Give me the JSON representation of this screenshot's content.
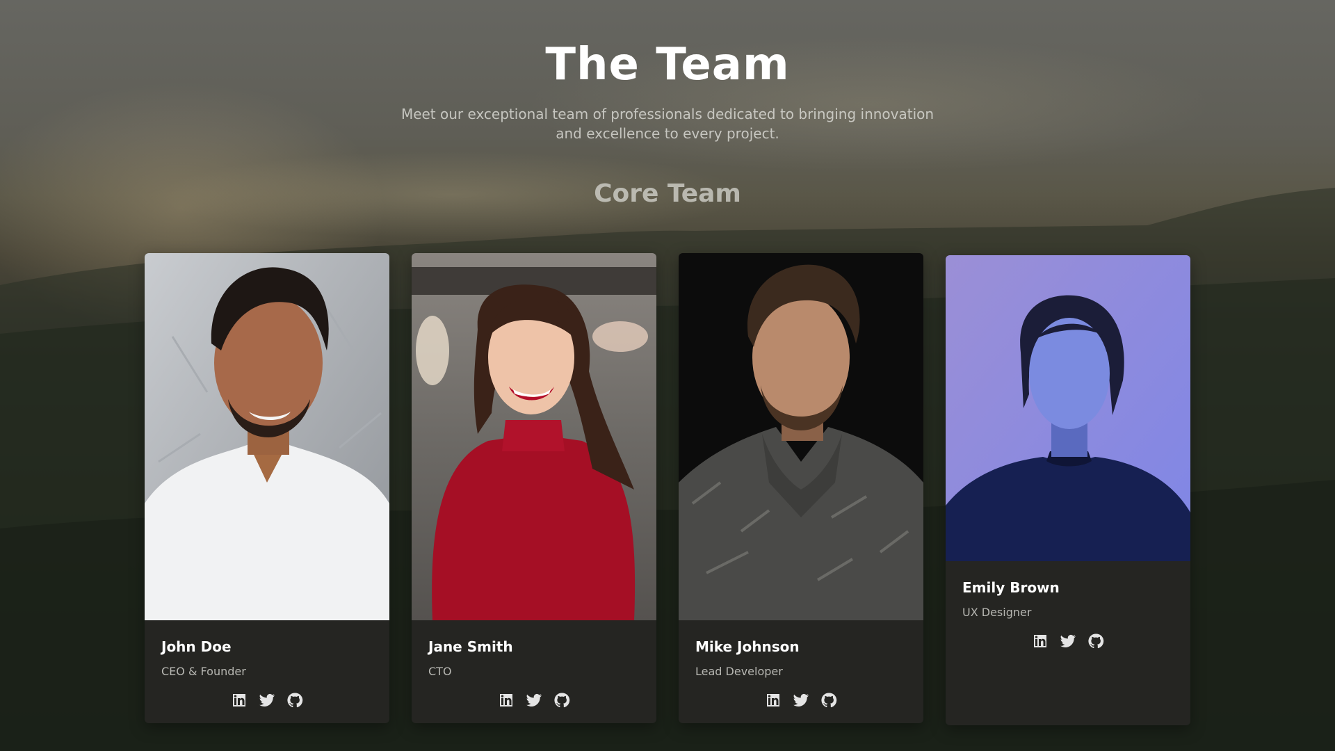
{
  "hero": {
    "title": "The Team",
    "subtitle": "Meet our exceptional team of professionals dedicated to bringing innovation and excellence to every project."
  },
  "section": {
    "title": "Core Team"
  },
  "members": [
    {
      "name": "John Doe",
      "role": "CEO & Founder",
      "photo": "portrait-man-white-tshirt"
    },
    {
      "name": "Jane Smith",
      "role": "CTO",
      "photo": "portrait-woman-red-top"
    },
    {
      "name": "Mike Johnson",
      "role": "Lead Developer",
      "photo": "portrait-man-gray-sweater"
    },
    {
      "name": "Emily Brown",
      "role": "UX Designer",
      "photo": "portrait-woman-blue-light"
    }
  ],
  "social_icons": [
    "linkedin-icon",
    "twitter-icon",
    "github-icon"
  ],
  "colors": {
    "card_background": "#262624",
    "icon": "#e4e4e4",
    "title": "#ffffff"
  }
}
